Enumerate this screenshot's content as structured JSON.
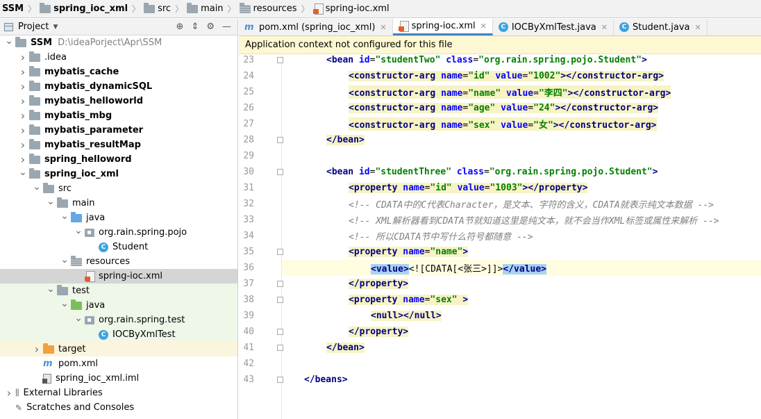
{
  "breadcrumb": [
    {
      "label": "SSM",
      "icon": "none",
      "bold": true
    },
    {
      "label": "spring_ioc_xml",
      "icon": "folder-icon",
      "bold": true
    },
    {
      "label": "src",
      "icon": "folder-icon",
      "bold": false
    },
    {
      "label": "main",
      "icon": "folder-icon",
      "bold": false
    },
    {
      "label": "resources",
      "icon": "resources-folder-icon",
      "bold": false
    },
    {
      "label": "spring-ioc.xml",
      "icon": "xml-file-icon",
      "bold": false
    }
  ],
  "project_panel": {
    "title": "Project",
    "tools": [
      "target-icon",
      "collapse-icon",
      "gear-icon",
      "minimize-icon"
    ],
    "tree": [
      {
        "depth": 0,
        "arrow": "down",
        "icon": "folder",
        "label": "SSM",
        "bold": true,
        "path": "D:\\ideaPorject\\Apr\\SSM"
      },
      {
        "depth": 1,
        "arrow": "right",
        "icon": "folder",
        "label": ".idea",
        "bold": false
      },
      {
        "depth": 1,
        "arrow": "right",
        "icon": "folder",
        "label": "mybatis_cache",
        "bold": true
      },
      {
        "depth": 1,
        "arrow": "right",
        "icon": "folder",
        "label": "mybatis_dynamicSQL",
        "bold": true
      },
      {
        "depth": 1,
        "arrow": "right",
        "icon": "folder",
        "label": "mybatis_helloworld",
        "bold": true
      },
      {
        "depth": 1,
        "arrow": "right",
        "icon": "folder",
        "label": "mybatis_mbg",
        "bold": true
      },
      {
        "depth": 1,
        "arrow": "right",
        "icon": "folder",
        "label": "mybatis_parameter",
        "bold": true
      },
      {
        "depth": 1,
        "arrow": "right",
        "icon": "folder",
        "label": "mybatis_resultMap",
        "bold": true
      },
      {
        "depth": 1,
        "arrow": "right",
        "icon": "folder",
        "label": "spring_helloword",
        "bold": true
      },
      {
        "depth": 1,
        "arrow": "down",
        "icon": "folder",
        "label": "spring_ioc_xml",
        "bold": true
      },
      {
        "depth": 2,
        "arrow": "down",
        "icon": "folder",
        "label": "src",
        "bold": false
      },
      {
        "depth": 3,
        "arrow": "down",
        "icon": "folder",
        "label": "main",
        "bold": false
      },
      {
        "depth": 4,
        "arrow": "down",
        "icon": "folder-blue",
        "label": "java",
        "bold": false
      },
      {
        "depth": 5,
        "arrow": "down",
        "icon": "package",
        "label": "org.rain.spring.pojo",
        "bold": false
      },
      {
        "depth": 6,
        "arrow": "none",
        "icon": "class",
        "label": "Student",
        "bold": false
      },
      {
        "depth": 4,
        "arrow": "down",
        "icon": "folder-res",
        "label": "resources",
        "bold": false
      },
      {
        "depth": 5,
        "arrow": "none",
        "icon": "xml",
        "label": "spring-ioc.xml",
        "bold": false,
        "selected": true
      },
      {
        "depth": 3,
        "arrow": "down",
        "icon": "folder",
        "label": "test",
        "bold": false,
        "green": true
      },
      {
        "depth": 4,
        "arrow": "down",
        "icon": "folder-green",
        "label": "java",
        "bold": false,
        "green": true
      },
      {
        "depth": 5,
        "arrow": "down",
        "icon": "package",
        "label": "org.rain.spring.test",
        "bold": false,
        "green": true
      },
      {
        "depth": 6,
        "arrow": "none",
        "icon": "class",
        "label": "IOCByXmlTest",
        "bold": false,
        "green": true
      },
      {
        "depth": 2,
        "arrow": "right",
        "icon": "folder-orange",
        "label": "target",
        "bold": false,
        "yellow": true
      },
      {
        "depth": 2,
        "arrow": "none",
        "icon": "maven",
        "label": "pom.xml",
        "bold": false
      },
      {
        "depth": 2,
        "arrow": "none",
        "icon": "iml",
        "label": "spring_ioc_xml.iml",
        "bold": false
      },
      {
        "depth": 0,
        "arrow": "right",
        "icon": "libraries",
        "label": "External Libraries",
        "bold": false
      },
      {
        "depth": 0,
        "arrow": "none",
        "icon": "scratches",
        "label": "Scratches and Consoles",
        "bold": false
      }
    ]
  },
  "editor": {
    "tabs": [
      {
        "label": "pom.xml (spring_ioc_xml)",
        "icon": "maven",
        "active": false
      },
      {
        "label": "spring-ioc.xml",
        "icon": "xml",
        "active": true
      },
      {
        "label": "IOCByXmlTest.java",
        "icon": "class",
        "active": false
      },
      {
        "label": "Student.java",
        "icon": "class",
        "active": false
      }
    ],
    "notice": "Application context not configured for this file",
    "current_line": 36,
    "lines": [
      {
        "num": "23",
        "fold": true,
        "indent": 1,
        "segs": [
          [
            "t-tag",
            "<bean "
          ],
          [
            "t-attr",
            "id"
          ],
          [
            "t-plain",
            "="
          ],
          [
            "t-val",
            "\"studentTwo\""
          ],
          [
            "t-plain",
            " "
          ],
          [
            "t-attr",
            "class"
          ],
          [
            "t-plain",
            "="
          ],
          [
            "t-val",
            "\"org.rain.spring.pojo.Student\""
          ],
          [
            "t-tag",
            ">"
          ]
        ]
      },
      {
        "num": "24",
        "fold": false,
        "indent": 2,
        "hl": "yel",
        "segs": [
          [
            "t-tag",
            "<constructor-arg "
          ],
          [
            "t-attr",
            "name"
          ],
          [
            "t-plain",
            "="
          ],
          [
            "t-val",
            "\"id\""
          ],
          [
            "t-plain",
            " "
          ],
          [
            "t-attr",
            "value"
          ],
          [
            "t-plain",
            "="
          ],
          [
            "t-val",
            "\"1002\""
          ],
          [
            "t-tag",
            "></constructor-arg>"
          ]
        ]
      },
      {
        "num": "25",
        "fold": false,
        "indent": 2,
        "hl": "yel",
        "segs": [
          [
            "t-tag",
            "<constructor-arg "
          ],
          [
            "t-attr",
            "name"
          ],
          [
            "t-plain",
            "="
          ],
          [
            "t-val",
            "\"name\""
          ],
          [
            "t-plain",
            " "
          ],
          [
            "t-attr",
            "value"
          ],
          [
            "t-plain",
            "="
          ],
          [
            "t-val",
            "\"李四\""
          ],
          [
            "t-tag",
            "></constructor-arg>"
          ]
        ]
      },
      {
        "num": "26",
        "fold": false,
        "indent": 2,
        "hl": "yel",
        "segs": [
          [
            "t-tag",
            "<constructor-arg "
          ],
          [
            "t-attr",
            "name"
          ],
          [
            "t-plain",
            "="
          ],
          [
            "t-val",
            "\"age\""
          ],
          [
            "t-plain",
            " "
          ],
          [
            "t-attr",
            "value"
          ],
          [
            "t-plain",
            "="
          ],
          [
            "t-val",
            "\"24\""
          ],
          [
            "t-tag",
            "></constructor-arg>"
          ]
        ]
      },
      {
        "num": "27",
        "fold": false,
        "indent": 2,
        "hl": "yel",
        "segs": [
          [
            "t-tag",
            "<constructor-arg "
          ],
          [
            "t-attr",
            "name"
          ],
          [
            "t-plain",
            "="
          ],
          [
            "t-val",
            "\"sex\""
          ],
          [
            "t-plain",
            " "
          ],
          [
            "t-attr",
            "value"
          ],
          [
            "t-plain",
            "="
          ],
          [
            "t-val",
            "\"女\""
          ],
          [
            "t-tag",
            "></constructor-arg>"
          ]
        ]
      },
      {
        "num": "28",
        "fold": true,
        "indent": 1,
        "hl": "yel",
        "segs": [
          [
            "t-tag",
            "</bean>"
          ]
        ]
      },
      {
        "num": "29",
        "fold": false,
        "indent": 0,
        "segs": []
      },
      {
        "num": "30",
        "fold": true,
        "indent": 1,
        "segs": [
          [
            "t-tag",
            "<bean "
          ],
          [
            "t-attr",
            "id"
          ],
          [
            "t-plain",
            "="
          ],
          [
            "t-val",
            "\"studentThree\""
          ],
          [
            "t-plain",
            " "
          ],
          [
            "t-attr",
            "class"
          ],
          [
            "t-plain",
            "="
          ],
          [
            "t-val",
            "\"org.rain.spring.pojo.Student\""
          ],
          [
            "t-tag",
            ">"
          ]
        ]
      },
      {
        "num": "31",
        "fold": false,
        "indent": 2,
        "hl": "yel",
        "segs": [
          [
            "t-tag",
            "<property "
          ],
          [
            "t-attr",
            "name"
          ],
          [
            "t-plain",
            "="
          ],
          [
            "t-val",
            "\"id\""
          ],
          [
            "t-plain",
            " "
          ],
          [
            "t-attr",
            "value"
          ],
          [
            "t-plain",
            "="
          ],
          [
            "t-val",
            "\"1003\""
          ],
          [
            "t-tag",
            "></property>"
          ]
        ]
      },
      {
        "num": "32",
        "fold": false,
        "indent": 2,
        "segs": [
          [
            "t-cmt",
            "<!-- CDATA中的C代表Character，是文本、字符的含义，CDATA就表示纯文本数据 -->"
          ]
        ]
      },
      {
        "num": "33",
        "fold": false,
        "indent": 2,
        "segs": [
          [
            "t-cmt",
            "<!-- XML解析器看到CDATA节就知道这里是纯文本，就不会当作XML标签或属性来解析 -->"
          ]
        ]
      },
      {
        "num": "34",
        "fold": false,
        "indent": 2,
        "segs": [
          [
            "t-cmt",
            "<!-- 所以CDATA节中写什么符号都随意 -->"
          ]
        ]
      },
      {
        "num": "35",
        "fold": true,
        "indent": 2,
        "hl": "yel",
        "segs": [
          [
            "t-tag",
            "<property "
          ],
          [
            "t-attr",
            "name"
          ],
          [
            "t-plain",
            "="
          ],
          [
            "t-val",
            "\"name\""
          ],
          [
            "t-tag",
            ">"
          ]
        ]
      },
      {
        "num": "36",
        "fold": false,
        "indent": 3,
        "bulb": true,
        "segs": [
          [
            "t-tag hl-blue",
            "<value>"
          ],
          [
            "t-plain",
            "<![CDATA[<张三>]]>"
          ],
          [
            "t-tag hl-blue",
            "</value>"
          ]
        ]
      },
      {
        "num": "37",
        "fold": true,
        "indent": 2,
        "hl": "yel",
        "segs": [
          [
            "t-tag",
            "</property>"
          ]
        ]
      },
      {
        "num": "38",
        "fold": true,
        "indent": 2,
        "hl": "yel",
        "segs": [
          [
            "t-tag",
            "<property "
          ],
          [
            "t-attr",
            "name"
          ],
          [
            "t-plain",
            "="
          ],
          [
            "t-val",
            "\"sex\""
          ],
          [
            "t-plain",
            " "
          ],
          [
            "t-tag",
            ">"
          ]
        ]
      },
      {
        "num": "39",
        "fold": false,
        "indent": 3,
        "hl": "yel",
        "segs": [
          [
            "t-tag",
            "<null></null>"
          ]
        ]
      },
      {
        "num": "40",
        "fold": true,
        "indent": 2,
        "hl": "yel",
        "segs": [
          [
            "t-tag",
            "</property>"
          ]
        ]
      },
      {
        "num": "41",
        "fold": true,
        "indent": 1,
        "hl": "yel",
        "segs": [
          [
            "t-tag",
            "</bean>"
          ]
        ]
      },
      {
        "num": "42",
        "fold": false,
        "indent": 0,
        "segs": []
      },
      {
        "num": "43",
        "fold": true,
        "indent": 0,
        "segs": [
          [
            "t-tag",
            "</beans>"
          ]
        ]
      }
    ]
  }
}
